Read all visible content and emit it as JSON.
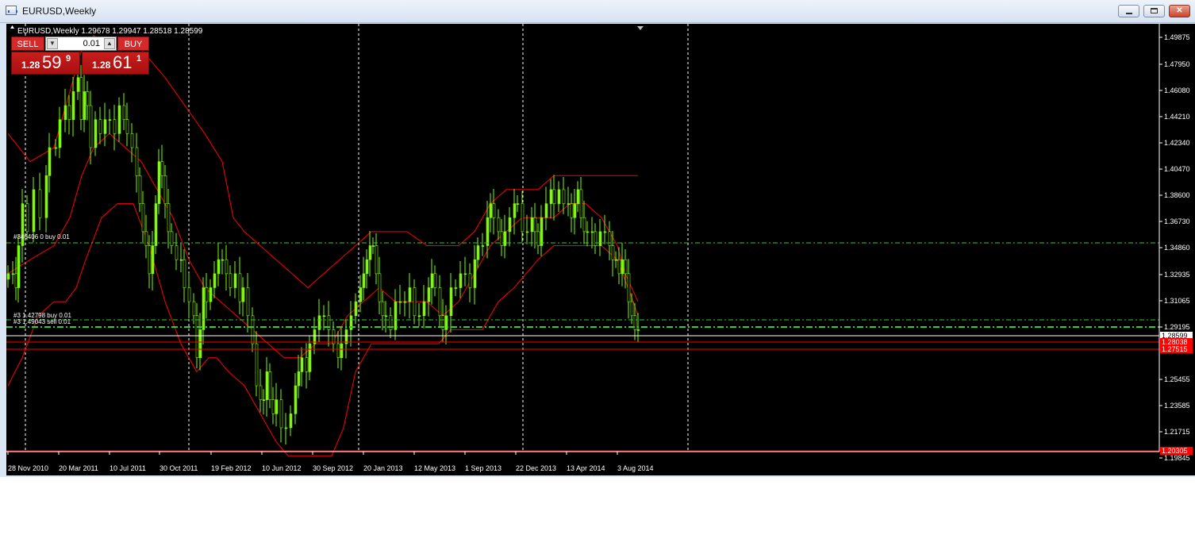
{
  "window": {
    "title": "EURUSD,Weekly",
    "controls": [
      "minimize-icon",
      "maximize-icon",
      "close-icon"
    ]
  },
  "chart": {
    "header": "EURUSD,Weekly  1.29678 1.29947 1.28518 1.28599",
    "price_scale": [
      "1.49875",
      "1.47950",
      "1.46080",
      "1.44210",
      "1.42340",
      "1.40470",
      "1.38600",
      "1.36730",
      "1.34860",
      "1.32935",
      "1.31065",
      "1.29195",
      "1.25455",
      "1.23585",
      "1.21715",
      "1.19845"
    ],
    "date_labels": [
      "28 Nov 2010",
      "20 Mar 2011",
      "10 Jul 2011",
      "30 Oct 2011",
      "19 Feb 2012",
      "10 Jun 2012",
      "30 Sep 2012",
      "20 Jan 2013",
      "12 May 2013",
      "1 Sep 2013",
      "22 Dec 2013",
      "13 Apr 2014",
      "3 Aug 2014"
    ],
    "price_tags": [
      {
        "label": "1.28599",
        "bg": "#ffffff",
        "fg": "#000000"
      },
      {
        "label": "1.28038",
        "bg": "#ff0000",
        "fg": "#ffffff"
      },
      {
        "label": "1.27515",
        "bg": "#ff0000",
        "fg": "#ffffff"
      },
      {
        "label": "1.20305",
        "bg": "#ff0000",
        "fg": "#ffffff"
      }
    ],
    "order_labels": [
      "#346406 0 buy 0.01",
      "#3 1.42798 buy 0.01",
      "#3 1.49043 sell 0.01"
    ],
    "colors": {
      "background": "#000000",
      "bull": "#7cfc00",
      "bands": "#ff0000",
      "order_lines": "#32cd32",
      "grid": "#ffffff",
      "text": "#ffffff"
    }
  },
  "trade_panel": {
    "sell_label": "SELL",
    "buy_label": "BUY",
    "lot": "0.01",
    "sell_price": {
      "small": "1.28",
      "big": "59",
      "sup": "9"
    },
    "buy_price": {
      "small": "1.28",
      "big": "61",
      "sup": "1"
    }
  }
}
